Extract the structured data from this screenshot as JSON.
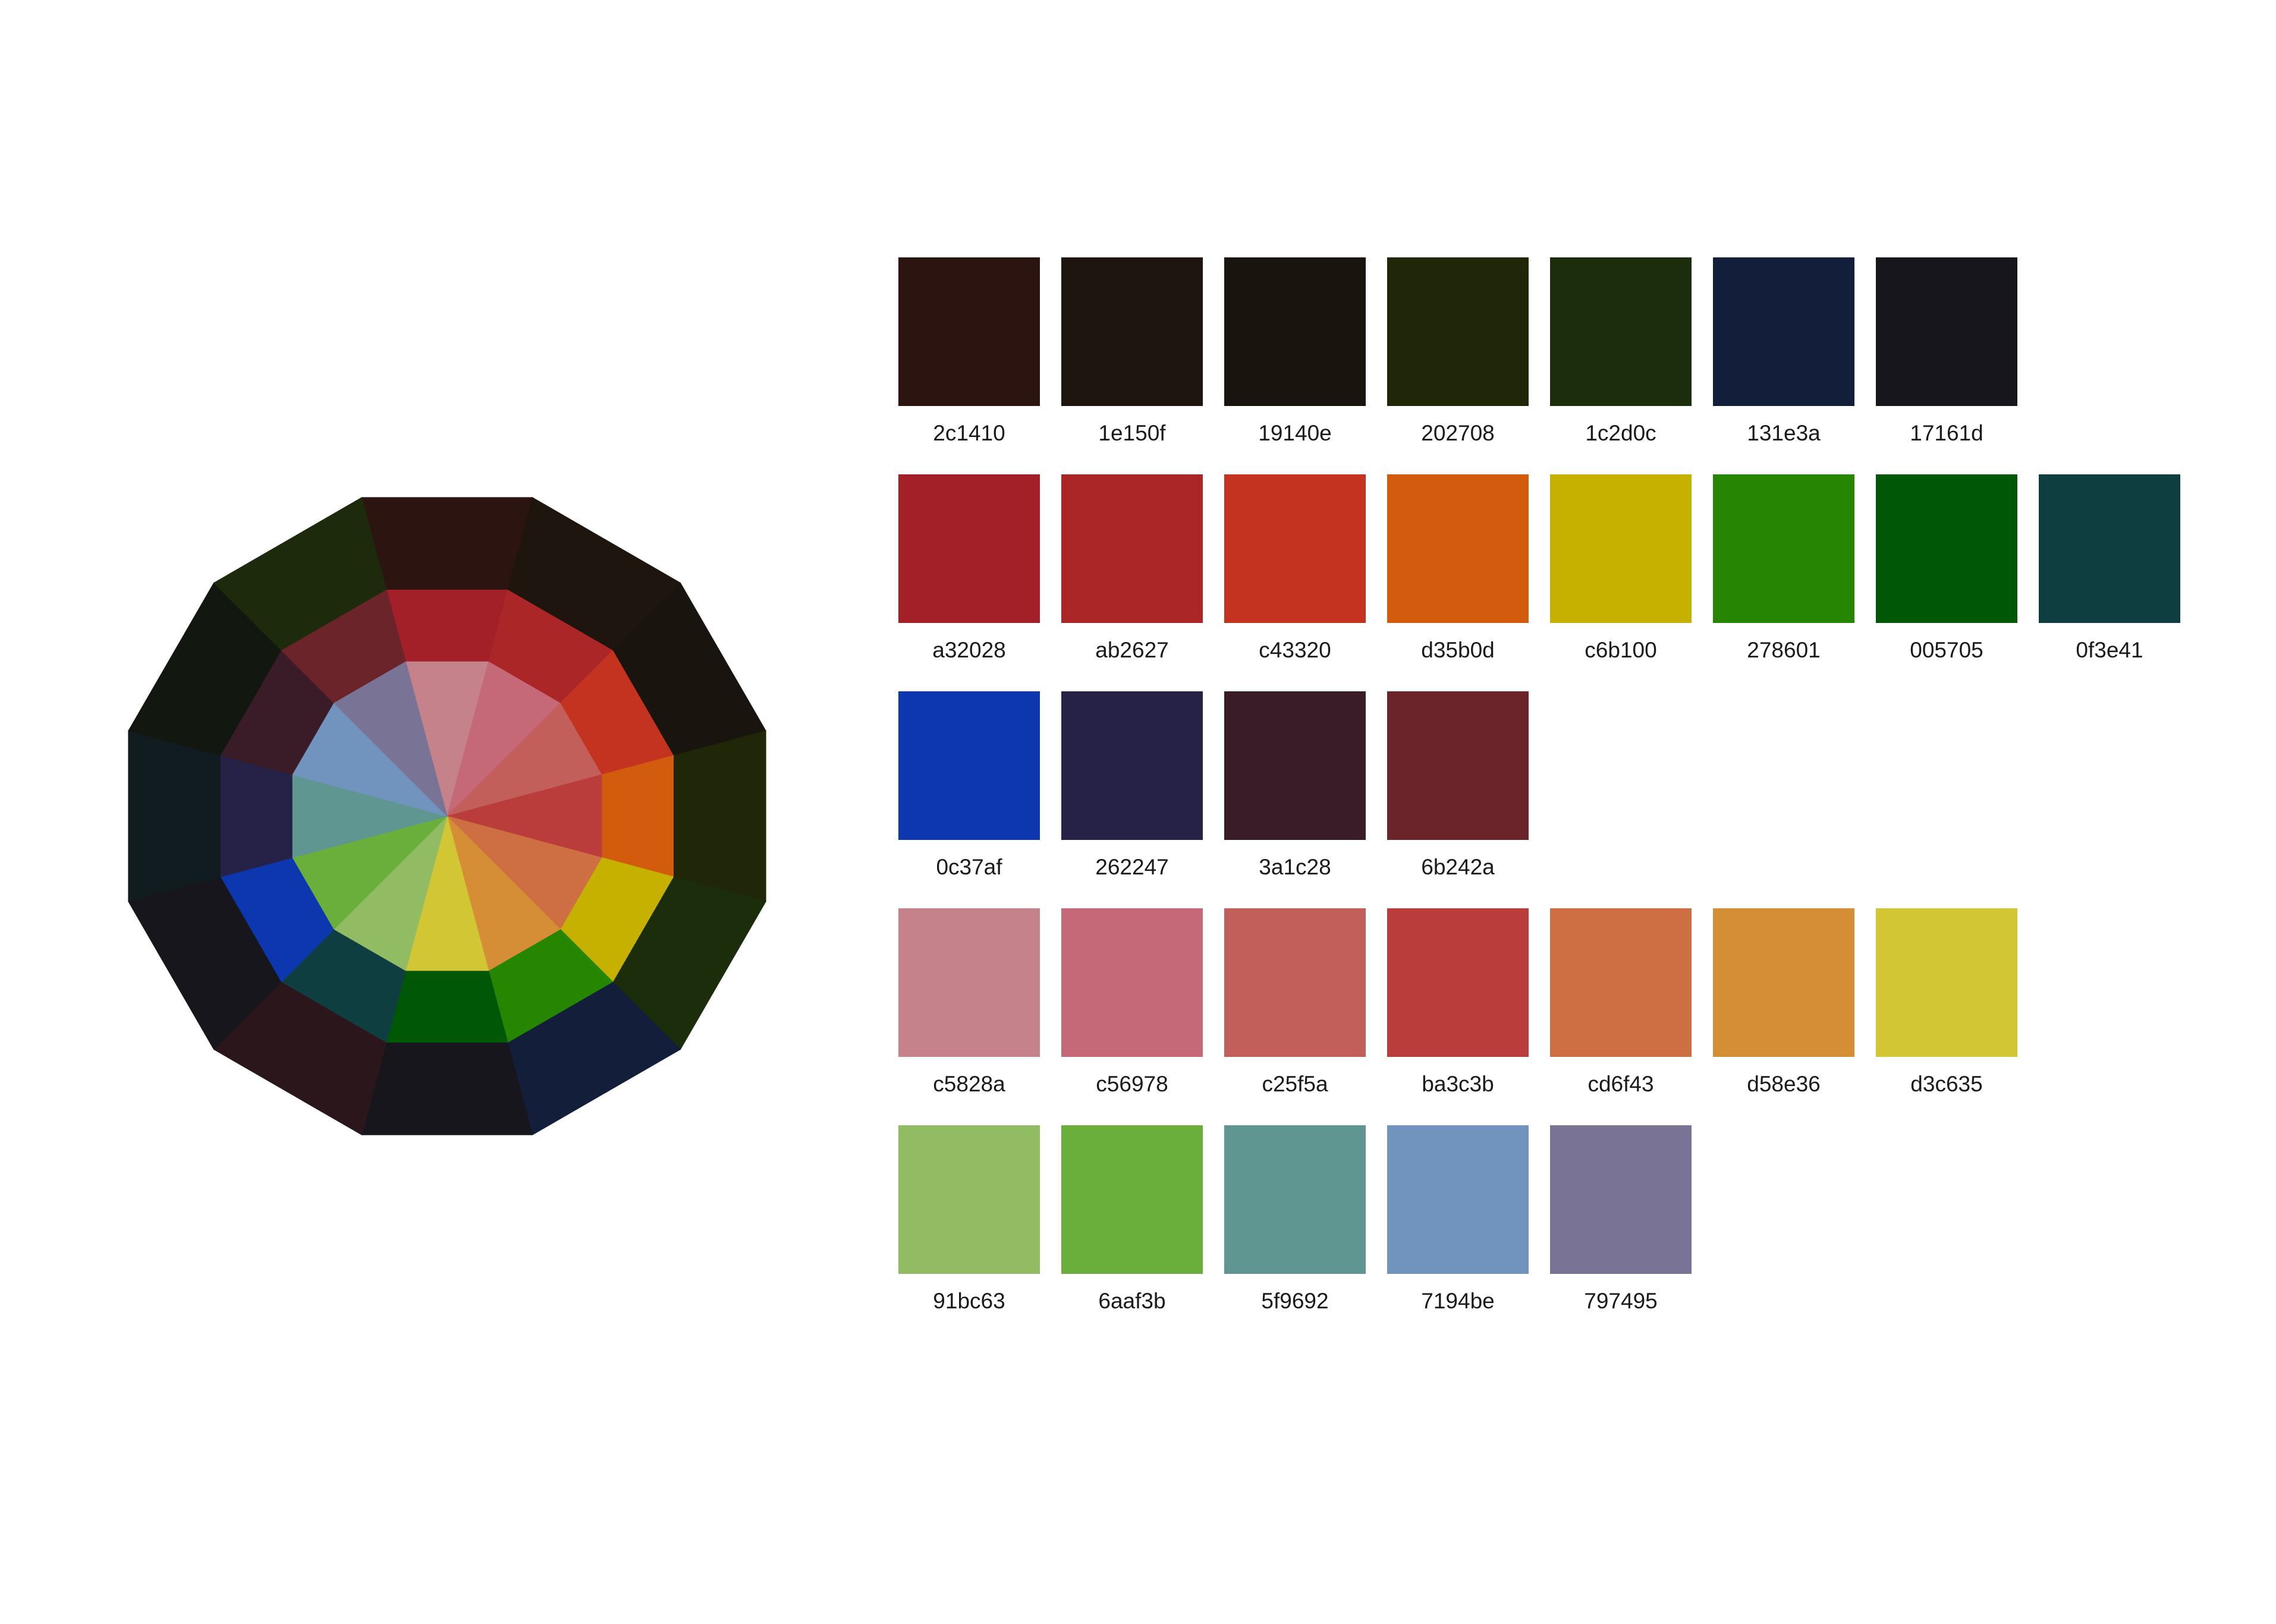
{
  "wheel": {
    "outer": [
      "2c1410",
      "1e150f",
      "19140e",
      "202708",
      "1c2d0c",
      "131e3a",
      "17161d",
      "2b171b",
      "17161d",
      "111c20",
      "12170f",
      "1d2a0c"
    ],
    "middle": [
      "a32028",
      "ab2627",
      "c43320",
      "d35b0d",
      "c6b100",
      "278601",
      "005705",
      "0f3e41",
      "0c37af",
      "262247",
      "3a1c28",
      "6b242a"
    ],
    "inner": [
      "c5828a",
      "c56978",
      "c25f5a",
      "ba3c3b",
      "cd6f43",
      "d58e36",
      "d3c635",
      "91bc63",
      "6aaf3b",
      "5f9692",
      "7194be",
      "797495"
    ]
  },
  "palette": {
    "rows": [
      [
        "2c1410",
        "1e150f",
        "19140e",
        "202708",
        "1c2d0c",
        "131e3a",
        "17161d"
      ],
      [
        "a32028",
        "ab2627",
        "c43320",
        "d35b0d",
        "c6b100",
        "278601",
        "005705",
        "0f3e41"
      ],
      [
        "0c37af",
        "262247",
        "3a1c28",
        "6b242a"
      ],
      [
        "c5828a",
        "c56978",
        "c25f5a",
        "ba3c3b",
        "cd6f43",
        "d58e36",
        "d3c635"
      ],
      [
        "91bc63",
        "6aaf3b",
        "5f9692",
        "7194be",
        "797495"
      ]
    ]
  }
}
